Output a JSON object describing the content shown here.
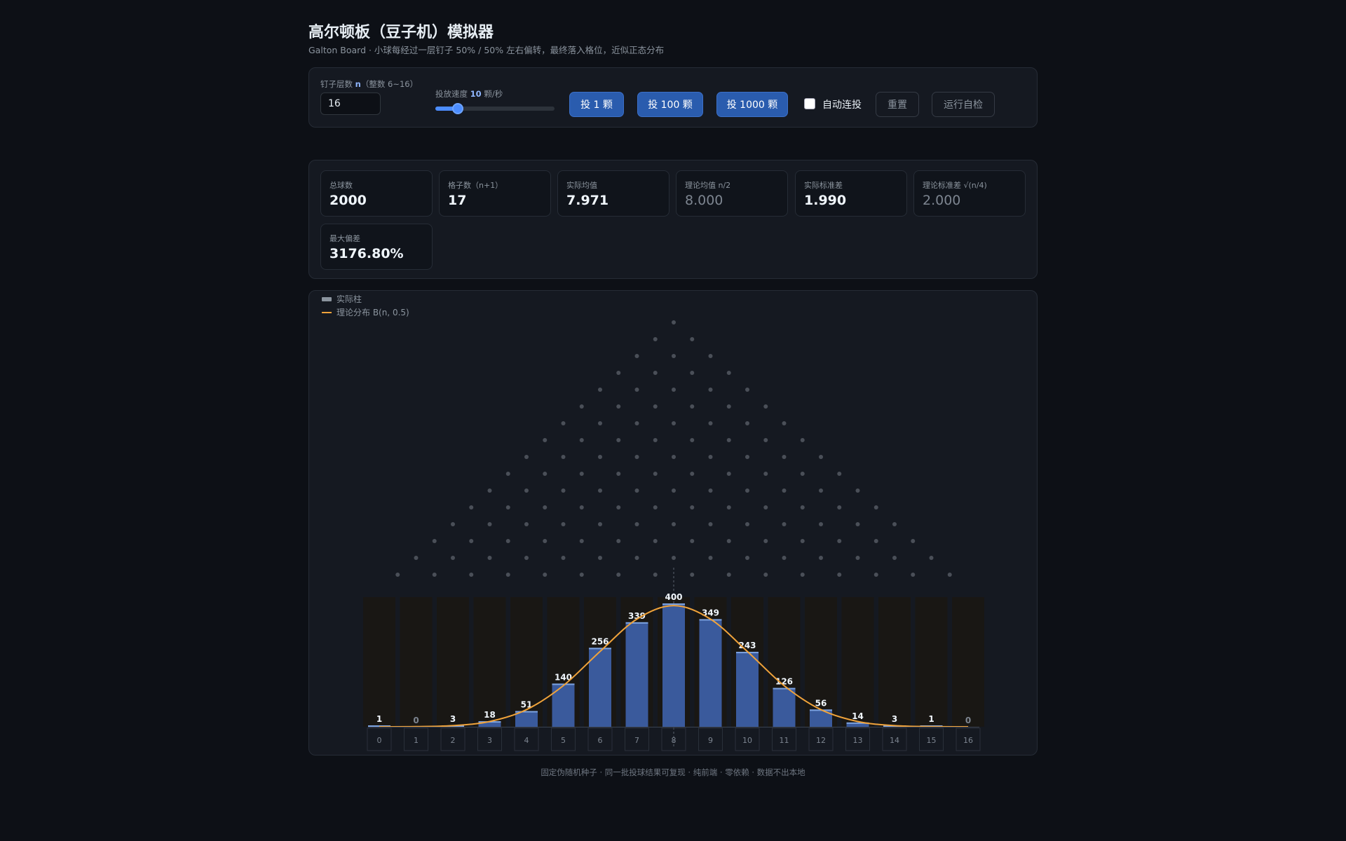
{
  "header": {
    "title": "高尔顿板（豆子机）模拟器",
    "subtitle": "Galton Board · 小球每经过一层钉子 50% / 50% 左右偏转，最终落入格位，近似正态分布"
  },
  "controls": {
    "rows_label_prefix": "钉子层数",
    "rows_label_var": "n",
    "rows_label_suffix": "（整数 6~16）",
    "rows_value": "16",
    "speed_label_prefix": "投放速度",
    "speed_value": "10",
    "speed_label_suffix": "颗/秒",
    "speed_fraction": 0.18,
    "drop_1": "投 1 颗",
    "drop_100": "投 100 颗",
    "drop_1000": "投 1000 颗",
    "auto_label": "自动连投",
    "auto_checked": false,
    "reset": "重置",
    "selftest": "运行自检"
  },
  "stats": [
    {
      "label": "总球数",
      "value": "2000",
      "muted": false
    },
    {
      "label": "格子数（n+1）",
      "value": "17",
      "muted": false
    },
    {
      "label": "实际均值",
      "value": "7.971",
      "muted": false
    },
    {
      "label": "理论均值 n/2",
      "value": "8.000",
      "muted": true
    },
    {
      "label": "实际标准差",
      "value": "1.990",
      "muted": false
    },
    {
      "label": "理论标准差 √(n/4)",
      "value": "2.000",
      "muted": true
    },
    {
      "label": "最大偏差",
      "value": "3176.80%",
      "muted": false
    }
  ],
  "legend": {
    "actual": "实际柱",
    "theory": "理论分布 B(n, 0.5)"
  },
  "colors": {
    "bar": "#3a5a9c",
    "bar_top": "#7da3e0",
    "curve": "#f0a33b",
    "peg": "#4a4f58",
    "accent": "#4c8dff"
  },
  "chart_data": {
    "type": "bar",
    "rows": 16,
    "categories": [
      "0",
      "1",
      "2",
      "3",
      "4",
      "5",
      "6",
      "7",
      "8",
      "9",
      "10",
      "11",
      "12",
      "13",
      "14",
      "15",
      "16"
    ],
    "values": [
      1,
      0,
      3,
      18,
      51,
      140,
      256,
      339,
      400,
      349,
      243,
      126,
      56,
      14,
      3,
      1,
      0
    ],
    "total": 2000,
    "theory": "B(n, 0.5)"
  },
  "footer": "固定伪随机种子 · 同一批投球结果可复现 · 纯前端 · 零依赖 · 数据不出本地"
}
